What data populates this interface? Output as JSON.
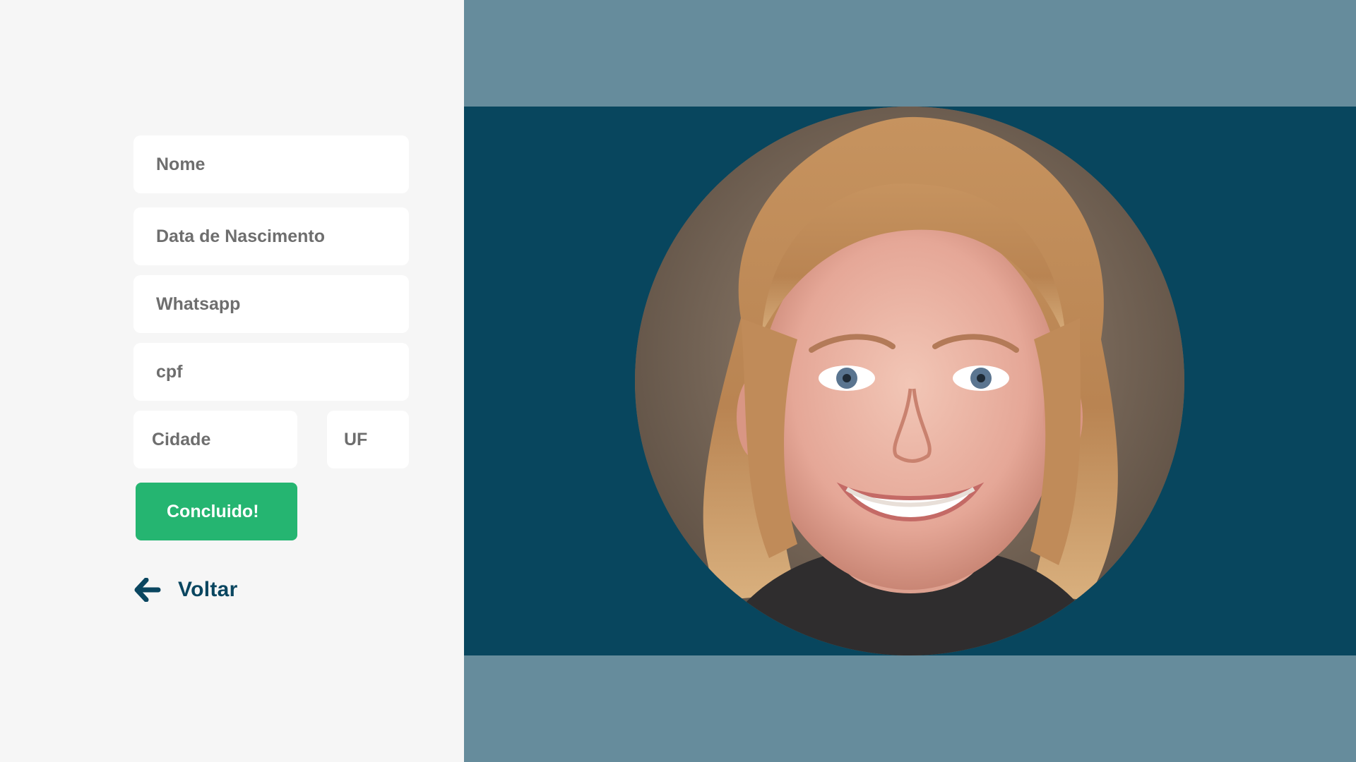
{
  "form": {
    "fields": {
      "nome": {
        "placeholder": "Nome",
        "value": ""
      },
      "data_nascimento": {
        "placeholder": "Data de Nascimento",
        "value": ""
      },
      "whatsapp": {
        "placeholder": "Whatsapp",
        "value": ""
      },
      "cpf": {
        "placeholder": "cpf",
        "value": ""
      },
      "cidade": {
        "placeholder": "Cidade",
        "value": ""
      },
      "uf": {
        "placeholder": "UF",
        "value": ""
      }
    },
    "submit_label": "Concluido!",
    "back_label": "Voltar",
    "back_icon": "arrow-left-icon"
  },
  "colors": {
    "left_background": "#f6f6f6",
    "right_background": "#668c9c",
    "photo_band": "#08465e",
    "accent_green": "#25b571",
    "text_dark": "#0a4660",
    "placeholder_gray": "#6e6e6e"
  },
  "profile_photo": {
    "shape": "circle",
    "icon": "profile-photo"
  }
}
